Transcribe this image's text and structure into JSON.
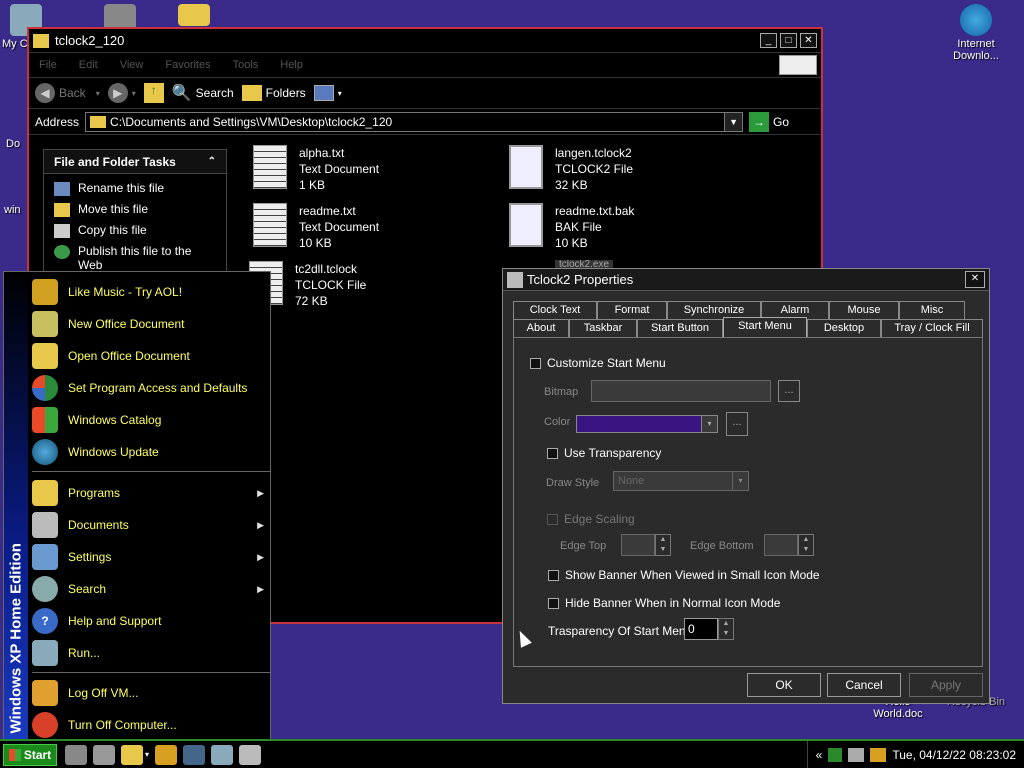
{
  "desktop": {
    "icons": [
      {
        "label": "My C",
        "name": "my-computer"
      },
      {
        "label": "Do",
        "name": "documents"
      },
      {
        "label": "win",
        "name": "win"
      },
      {
        "label": "Internet Downlo...",
        "name": "internet-download"
      },
      {
        "label": "Hello World.doc",
        "name": "hello-world-doc"
      },
      {
        "label": "Recycle Bin",
        "name": "recycle-bin"
      }
    ]
  },
  "explorer": {
    "title": "tclock2_120",
    "menu": [
      "File",
      "Edit",
      "View",
      "Favorites",
      "Tools",
      "Help"
    ],
    "toolbar": {
      "back": "Back",
      "search": "Search",
      "folders": "Folders"
    },
    "address_label": "Address",
    "address_value": "C:\\Documents and Settings\\VM\\Desktop\\tclock2_120",
    "go_label": "Go",
    "task_pane": {
      "header": "File and Folder Tasks",
      "items": [
        "Rename this file",
        "Move this file",
        "Copy this file",
        "Publish this file to the Web"
      ]
    },
    "files": [
      {
        "name": "alpha.txt",
        "type": "Text Document",
        "size": "1 KB"
      },
      {
        "name": "langen.tclock2",
        "type": "TCLOCK2 File",
        "size": "32 KB"
      },
      {
        "name": "readme.txt",
        "type": "Text Document",
        "size": "10 KB"
      },
      {
        "name": "readme.txt.bak",
        "type": "BAK File",
        "size": "10 KB"
      },
      {
        "name": "tc2dll.tclock",
        "type": "TCLOCK File",
        "size": "72 KB"
      },
      {
        "name": "tclock2.exe",
        "type": "",
        "size": ""
      }
    ]
  },
  "start_menu": {
    "banner": "Windows XP Home Edition",
    "pinned": [
      "Like Music - Try AOL!",
      "New Office Document",
      "Open Office Document",
      "Set Program Access and Defaults",
      "Windows Catalog",
      "Windows Update"
    ],
    "programs": [
      "Programs",
      "Documents",
      "Settings",
      "Search",
      "Help and Support",
      "Run..."
    ],
    "logoff": "Log Off VM...",
    "shutdown": "Turn Off Computer..."
  },
  "dialog": {
    "title": "Tclock2 Properties",
    "tabs_row1": [
      "Clock Text",
      "Format",
      "Synchronize",
      "Alarm",
      "Mouse",
      "Misc"
    ],
    "tabs_row2": [
      "About",
      "Taskbar",
      "Start Button",
      "Start Menu",
      "Desktop",
      "Tray / Clock Fill"
    ],
    "active_tab": "Start Menu",
    "customize_start_menu": "Customize Start Menu",
    "bitmap_label": "Bitmap",
    "color_label": "Color",
    "color_value": "#3a1480",
    "use_transparency": "Use Transparency",
    "draw_style_label": "Draw Style",
    "draw_style_value": "None",
    "edge_scaling": "Edge Scaling",
    "edge_top_label": "Edge Top",
    "edge_bottom_label": "Edge Bottom",
    "show_banner": "Show Banner When Viewed in Small Icon Mode",
    "hide_banner": "Hide Banner When in Normal Icon Mode",
    "transparency_label": "Trasparency Of Start Menu",
    "transparency_value": "0",
    "browse_label": "...",
    "ok": "OK",
    "cancel": "Cancel",
    "apply": "Apply"
  },
  "taskbar": {
    "start": "Start",
    "clock": "Tue, 04/12/22 08:23:02",
    "chevron": "«"
  }
}
